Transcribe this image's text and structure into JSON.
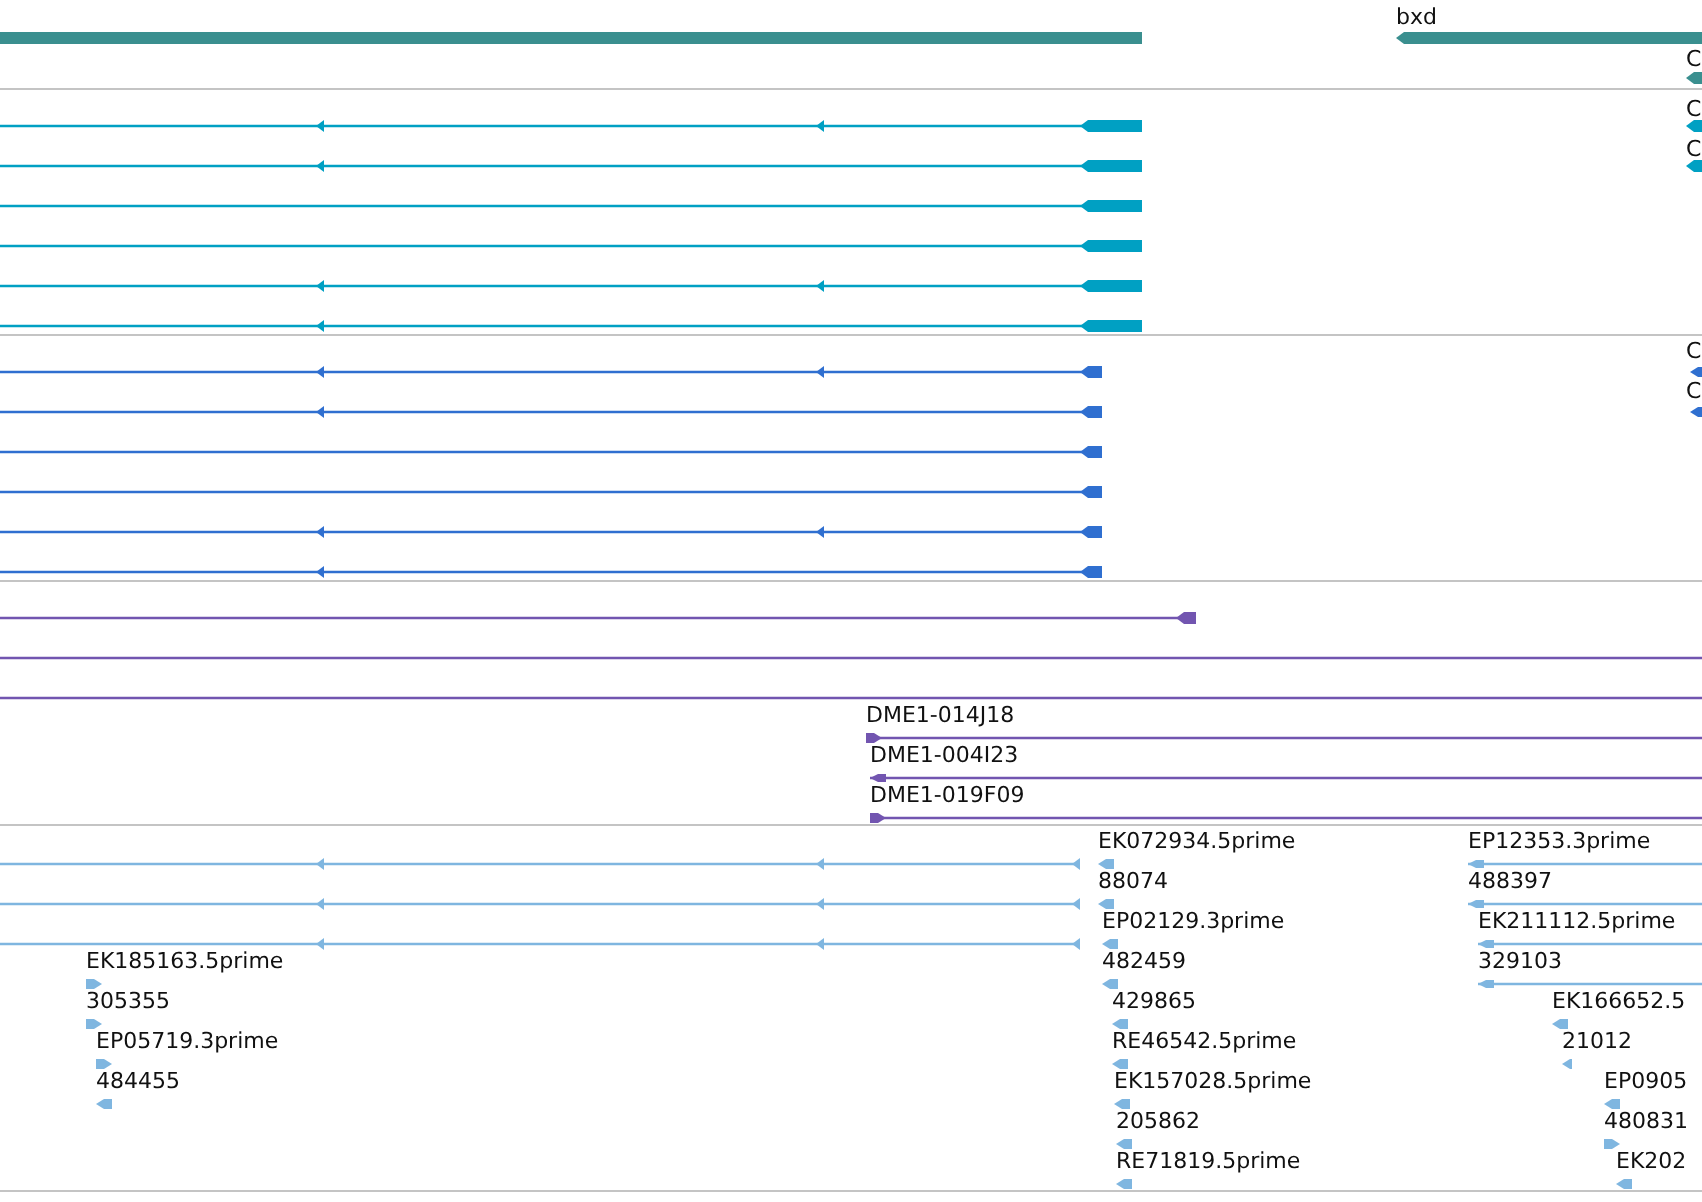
{
  "tracks": [
    {
      "color": "#3a8f8f",
      "features": [
        {
          "kind": "bar",
          "reverse": true
        },
        {
          "kind": "bar",
          "label": "bxd",
          "reverse": true
        },
        {
          "kind": "block",
          "label": "C",
          "reverse": true
        }
      ]
    },
    {
      "color": "#00a0c3",
      "features": [
        {
          "kind": "transcript",
          "reverse": true
        },
        {
          "kind": "transcript",
          "reverse": true
        },
        {
          "kind": "transcript",
          "reverse": true
        },
        {
          "kind": "transcript",
          "reverse": true
        },
        {
          "kind": "transcript",
          "reverse": true
        },
        {
          "kind": "transcript",
          "reverse": true
        },
        {
          "kind": "block",
          "label": "C",
          "reverse": true
        },
        {
          "kind": "block",
          "label": "C",
          "reverse": true
        }
      ]
    },
    {
      "color": "#2f6fd0",
      "features": [
        {
          "kind": "transcript",
          "reverse": true
        },
        {
          "kind": "transcript",
          "reverse": true
        },
        {
          "kind": "transcript",
          "reverse": true
        },
        {
          "kind": "transcript",
          "reverse": true
        },
        {
          "kind": "transcript",
          "reverse": true
        },
        {
          "kind": "transcript",
          "reverse": true
        },
        {
          "kind": "block",
          "label": "C",
          "reverse": true
        },
        {
          "kind": "block",
          "label": "C",
          "reverse": true
        }
      ]
    },
    {
      "color": "#7255b0",
      "features": [
        {
          "kind": "transcript",
          "reverse": true
        },
        {
          "kind": "line"
        },
        {
          "kind": "line"
        },
        {
          "kind": "transcript",
          "label": "DME1-014J18",
          "reverse": false
        },
        {
          "kind": "transcript",
          "label": "DME1-004I23",
          "reverse": true
        },
        {
          "kind": "transcript",
          "label": "DME1-019F09",
          "reverse": false
        }
      ]
    },
    {
      "color": "#7fb6e0",
      "features": [
        {
          "kind": "transcript",
          "reverse": true
        },
        {
          "kind": "transcript",
          "reverse": true
        },
        {
          "kind": "transcript",
          "reverse": true
        },
        {
          "kind": "block",
          "label": "EK185163.5prime",
          "reverse": false
        },
        {
          "kind": "block",
          "label": "305355",
          "reverse": false
        },
        {
          "kind": "block",
          "label": "EP05719.3prime",
          "reverse": false
        },
        {
          "kind": "block",
          "label": "484455",
          "reverse": true
        },
        {
          "kind": "block",
          "label": "EK072934.5prime",
          "reverse": true
        },
        {
          "kind": "block",
          "label": "88074",
          "reverse": true
        },
        {
          "kind": "block",
          "label": "EP02129.3prime",
          "reverse": true
        },
        {
          "kind": "block",
          "label": "482459",
          "reverse": true
        },
        {
          "kind": "block",
          "label": "429865",
          "reverse": true
        },
        {
          "kind": "block",
          "label": "RE46542.5prime",
          "reverse": true
        },
        {
          "kind": "block",
          "label": "EK157028.5prime",
          "reverse": true
        },
        {
          "kind": "block",
          "label": "205862",
          "reverse": true
        },
        {
          "kind": "block",
          "label": "RE71819.5prime",
          "reverse": true
        },
        {
          "kind": "transcript",
          "label": "EP12353.3prime",
          "reverse": true
        },
        {
          "kind": "transcript",
          "label": "488397",
          "reverse": true
        },
        {
          "kind": "transcript",
          "label": "EK211112.5prime",
          "reverse": true
        },
        {
          "kind": "transcript",
          "label": "329103",
          "reverse": true
        },
        {
          "kind": "block",
          "label": "EK166652.5",
          "reverse": true
        },
        {
          "kind": "block",
          "label": "21012",
          "reverse": true
        },
        {
          "kind": "block",
          "label": "EP0905",
          "reverse": true
        },
        {
          "kind": "block",
          "label": "480831",
          "reverse": false
        },
        {
          "kind": "block",
          "label": "EK202",
          "reverse": true
        }
      ]
    }
  ]
}
